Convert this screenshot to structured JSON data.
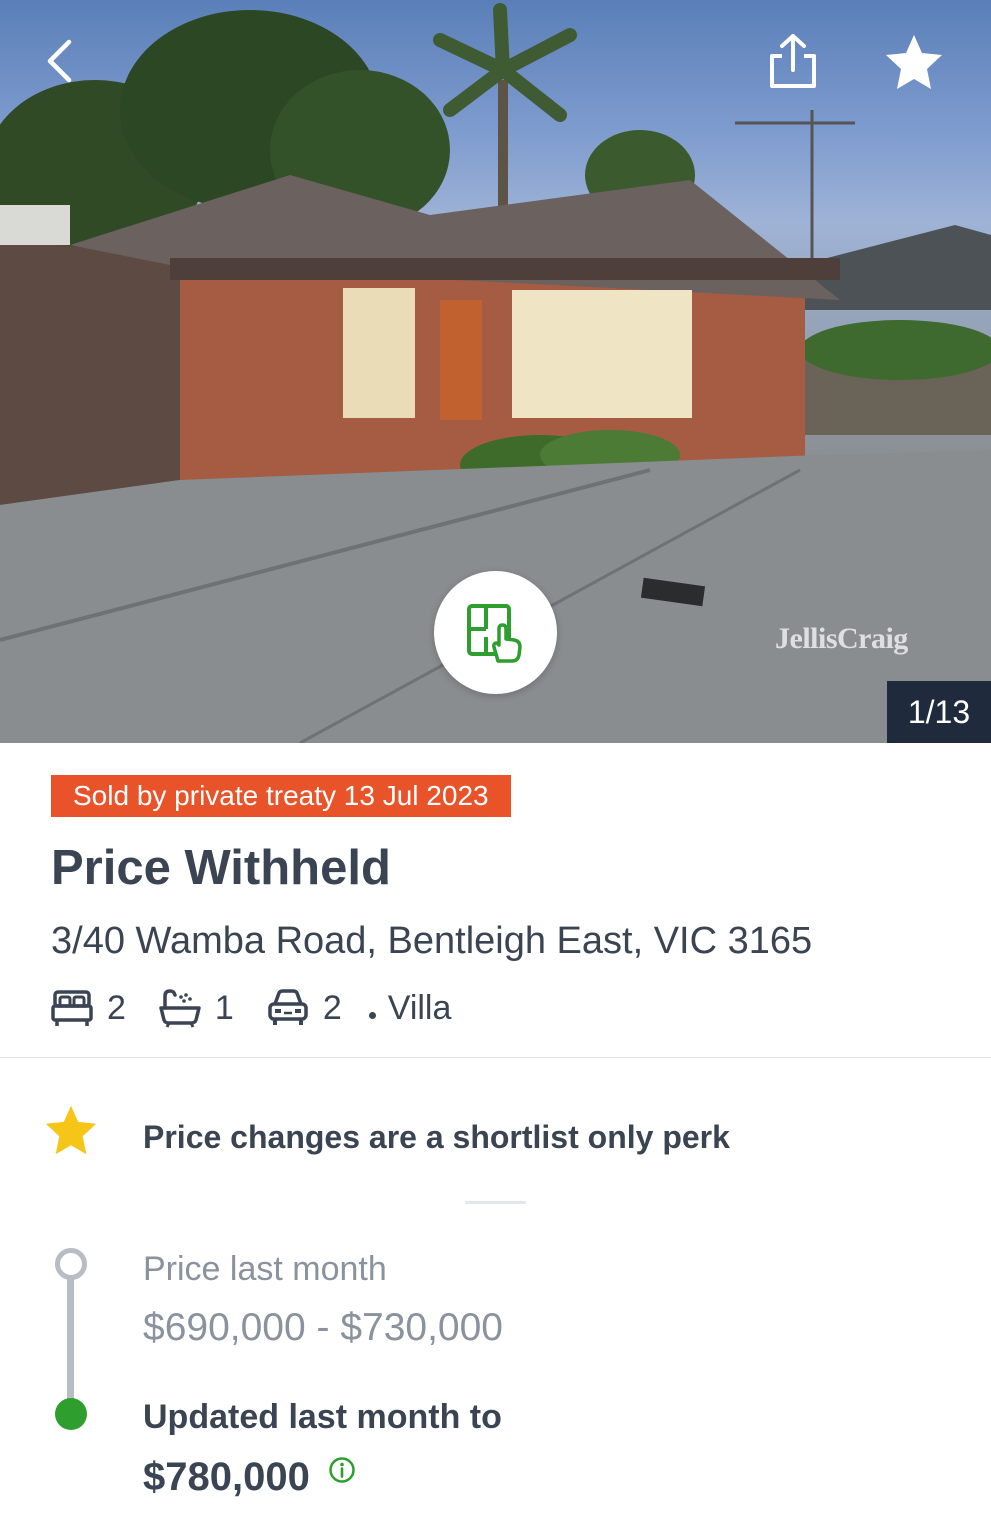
{
  "hero": {
    "watermark": "JellisCraig",
    "photo_counter": "1/13",
    "icons": {
      "back": "chevron-left-icon",
      "share": "share-icon",
      "shortlist": "star-icon",
      "floorplan": "floorplan-touch-icon"
    }
  },
  "listing": {
    "sold_badge": "Sold by private treaty 13 Jul 2023",
    "price": "Price Withheld",
    "address": "3/40 Wamba Road, Bentleigh East, VIC 3165",
    "features": {
      "bedrooms": "2",
      "bathrooms": "1",
      "parking": "2",
      "property_type": "Villa"
    }
  },
  "perk": {
    "text": "Price changes are a shortlist only perk"
  },
  "price_history": {
    "previous_label": "Price last month",
    "previous_range": "$690,000 - $730,000",
    "updated_label": "Updated last month to",
    "updated_value": "$780,000"
  },
  "colors": {
    "badge": "#e9532a",
    "accent_green": "#2e9e2e",
    "star_yellow": "#f5c518",
    "counter_bg": "#1f2b3d"
  }
}
